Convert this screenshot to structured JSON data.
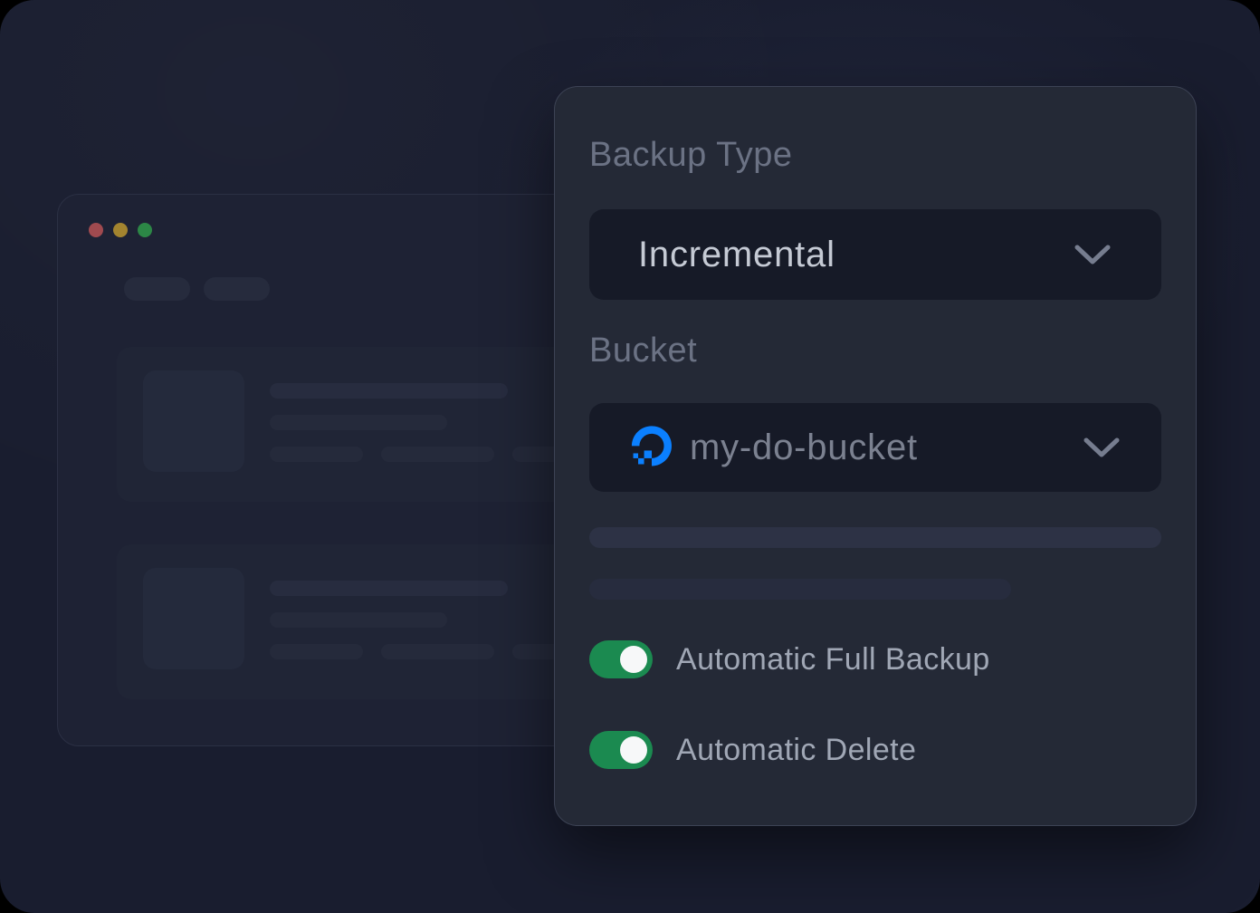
{
  "panel": {
    "backup_type": {
      "label": "Backup Type",
      "value": "Incremental"
    },
    "bucket": {
      "label": "Bucket",
      "value": "my-do-bucket"
    },
    "toggles": [
      {
        "label": "Automatic Full Backup",
        "on": true
      },
      {
        "label": "Automatic Delete",
        "on": true
      }
    ]
  },
  "window_mockup": {
    "traffic_lights": [
      "close",
      "minimize",
      "zoom"
    ]
  },
  "colors": {
    "accent_toggle_green": "#1b8a50",
    "brand_digitalocean_blue": "#0b80ff",
    "panel_background": "#242936",
    "page_background": "#191d2f",
    "select_background": "#161a27",
    "traffic_red": "#a04a4f",
    "traffic_yellow": "#a3842f",
    "traffic_green": "#2c8746"
  },
  "icons": {
    "chevron": "chevron-down-icon",
    "bucket_provider": "digitalocean-icon"
  }
}
